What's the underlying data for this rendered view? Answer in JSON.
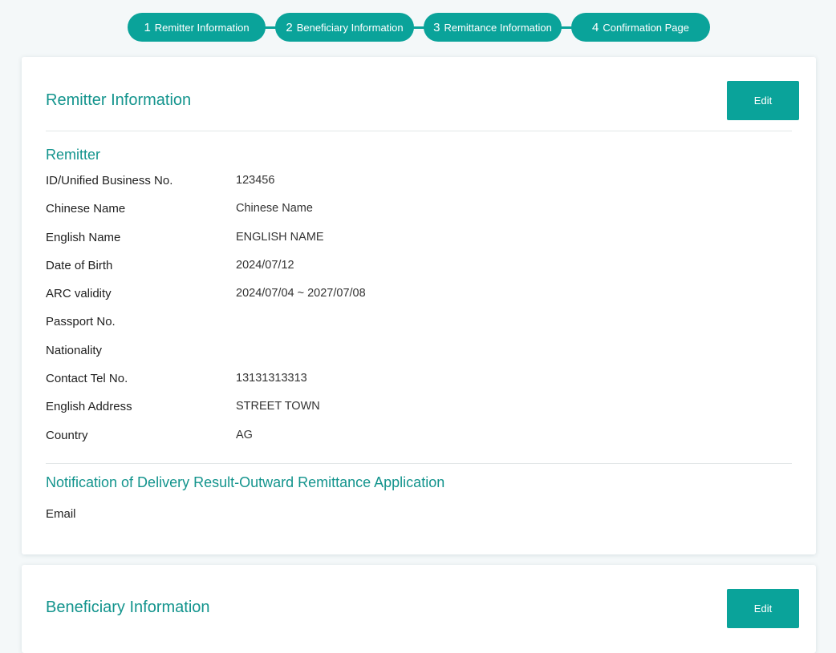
{
  "steps": [
    {
      "num": "1",
      "label": "Remitter Information"
    },
    {
      "num": "2",
      "label": "Beneficiary Information"
    },
    {
      "num": "3",
      "label": "Remittance Information"
    },
    {
      "num": "4",
      "label": "Confirmation Page"
    }
  ],
  "remitter_card": {
    "title": "Remitter Information",
    "edit_label": "Edit",
    "section_title": "Remitter",
    "fields": [
      {
        "label": "ID/Unified Business No.",
        "value": "123456"
      },
      {
        "label": "Chinese Name",
        "value": "Chinese Name"
      },
      {
        "label": "English Name",
        "value": "ENGLISH NAME"
      },
      {
        "label": "Date of Birth",
        "value": "2024/07/12"
      },
      {
        "label": "ARC validity",
        "value": "2024/07/04 ~ 2027/07/08"
      },
      {
        "label": "Passport No.",
        "value": ""
      },
      {
        "label": "Nationality",
        "value": ""
      },
      {
        "label": "Contact Tel No.",
        "value": "13131313313"
      },
      {
        "label": "English Address",
        "value": "STREET TOWN"
      },
      {
        "label": "Country",
        "value": "AG"
      }
    ],
    "notification_title": "Notification of Delivery Result-Outward Remittance Application",
    "email_label": "Email",
    "email_value": ""
  },
  "beneficiary_card": {
    "title": "Beneficiary Information",
    "edit_label": "Edit"
  },
  "colors": {
    "accent": "#0aa39a",
    "heading": "#13948d",
    "background": "#f4f8f9"
  }
}
